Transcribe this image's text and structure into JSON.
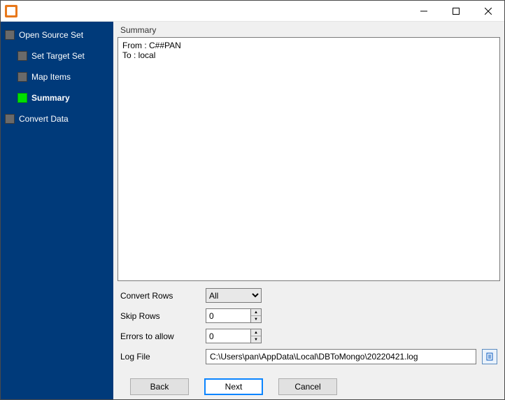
{
  "sidebar": {
    "items": [
      {
        "label": "Open Source Set",
        "active": false,
        "child": false
      },
      {
        "label": "Set Target Set",
        "active": false,
        "child": true
      },
      {
        "label": "Map Items",
        "active": false,
        "child": true
      },
      {
        "label": "Summary",
        "active": true,
        "child": true
      },
      {
        "label": "Convert Data",
        "active": false,
        "child": false
      }
    ]
  },
  "main": {
    "section_title": "Summary",
    "summary_text": "From : C##PAN\nTo : local",
    "options": {
      "convert_rows": {
        "label": "Convert Rows",
        "value": "All"
      },
      "skip_rows": {
        "label": "Skip Rows",
        "value": "0"
      },
      "errors_allow": {
        "label": "Errors to allow",
        "value": "0"
      },
      "log_file": {
        "label": "Log File",
        "value": "C:\\Users\\pan\\AppData\\Local\\DBToMongo\\20220421.log"
      }
    }
  },
  "buttons": {
    "back": "Back",
    "next": "Next",
    "cancel": "Cancel"
  }
}
